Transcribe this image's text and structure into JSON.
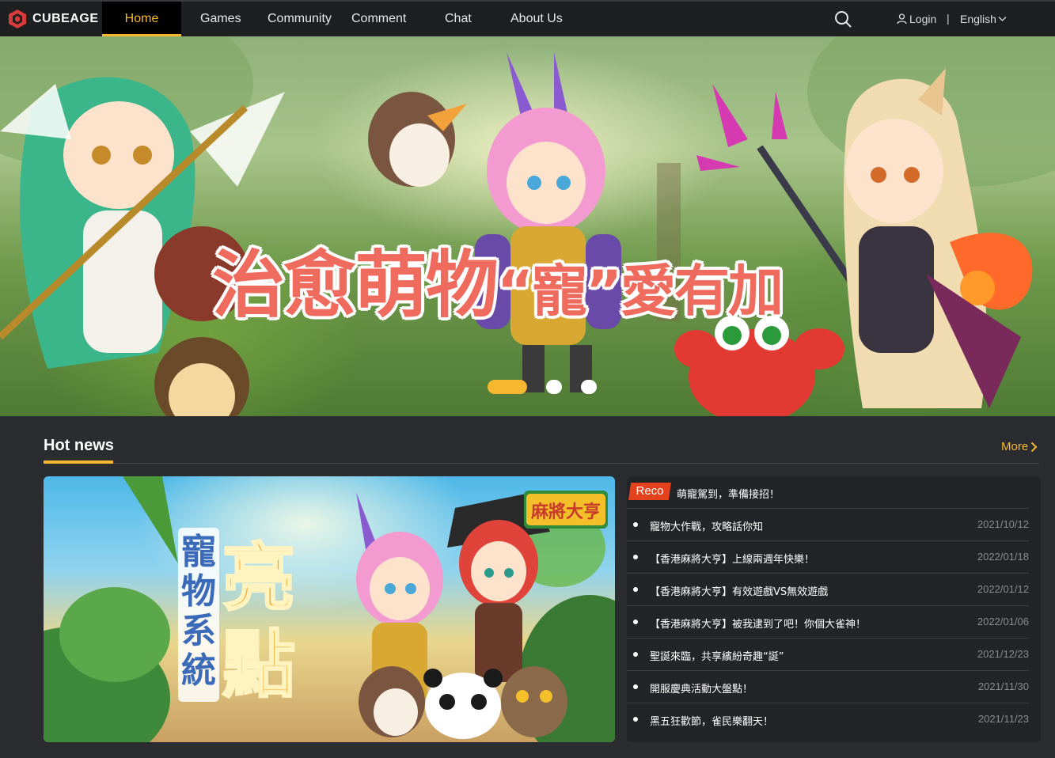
{
  "brand": {
    "name": "CUBEAGE"
  },
  "nav": {
    "items": [
      {
        "label": "Home",
        "active": true
      },
      {
        "label": "Games"
      },
      {
        "label": "Community"
      },
      {
        "label": "Comment"
      },
      {
        "label": "Chat"
      },
      {
        "label": "About Us"
      }
    ],
    "login_label": "Login",
    "separator": "|",
    "language_label": "English"
  },
  "hero": {
    "title_part1": "治愈萌物",
    "title_part2": "“寵”",
    "title_part3": "愛有加",
    "carousel": {
      "total": 3,
      "active_index": 0
    }
  },
  "hot_news": {
    "title": "Hot news",
    "more_label": "More",
    "featured_image": {
      "vertical_text_left": "寵物系統",
      "vertical_text_right": "亮點",
      "logo_text": "麻將大亨"
    },
    "reco": {
      "badge": "Reco",
      "title": "萌寵駕到，準備接招！"
    },
    "items": [
      {
        "title": "寵物大作戰，攻略話你知",
        "date": "2021/10/12"
      },
      {
        "title": "【香港麻將大亨】上線兩週年快樂！",
        "date": "2022/01/18"
      },
      {
        "title": "【香港麻將大亨】有效遊戲VS無效遊戲",
        "date": "2022/01/12"
      },
      {
        "title": "【香港麻將大亨】被我逮到了吧！你個大雀神！",
        "date": "2022/01/06"
      },
      {
        "title": "聖誕來臨，共享繽紛奇趣“誕”",
        "date": "2021/12/23"
      },
      {
        "title": "開服慶典活動大盤點！",
        "date": "2021/11/30"
      },
      {
        "title": "黑五狂歡節，雀民樂翻天！",
        "date": "2021/11/23"
      }
    ]
  },
  "colors": {
    "accent": "#f7b731",
    "nav_bg": "#1e1f21",
    "page_bg": "#2b2c2f",
    "reco": "#e4421c"
  }
}
